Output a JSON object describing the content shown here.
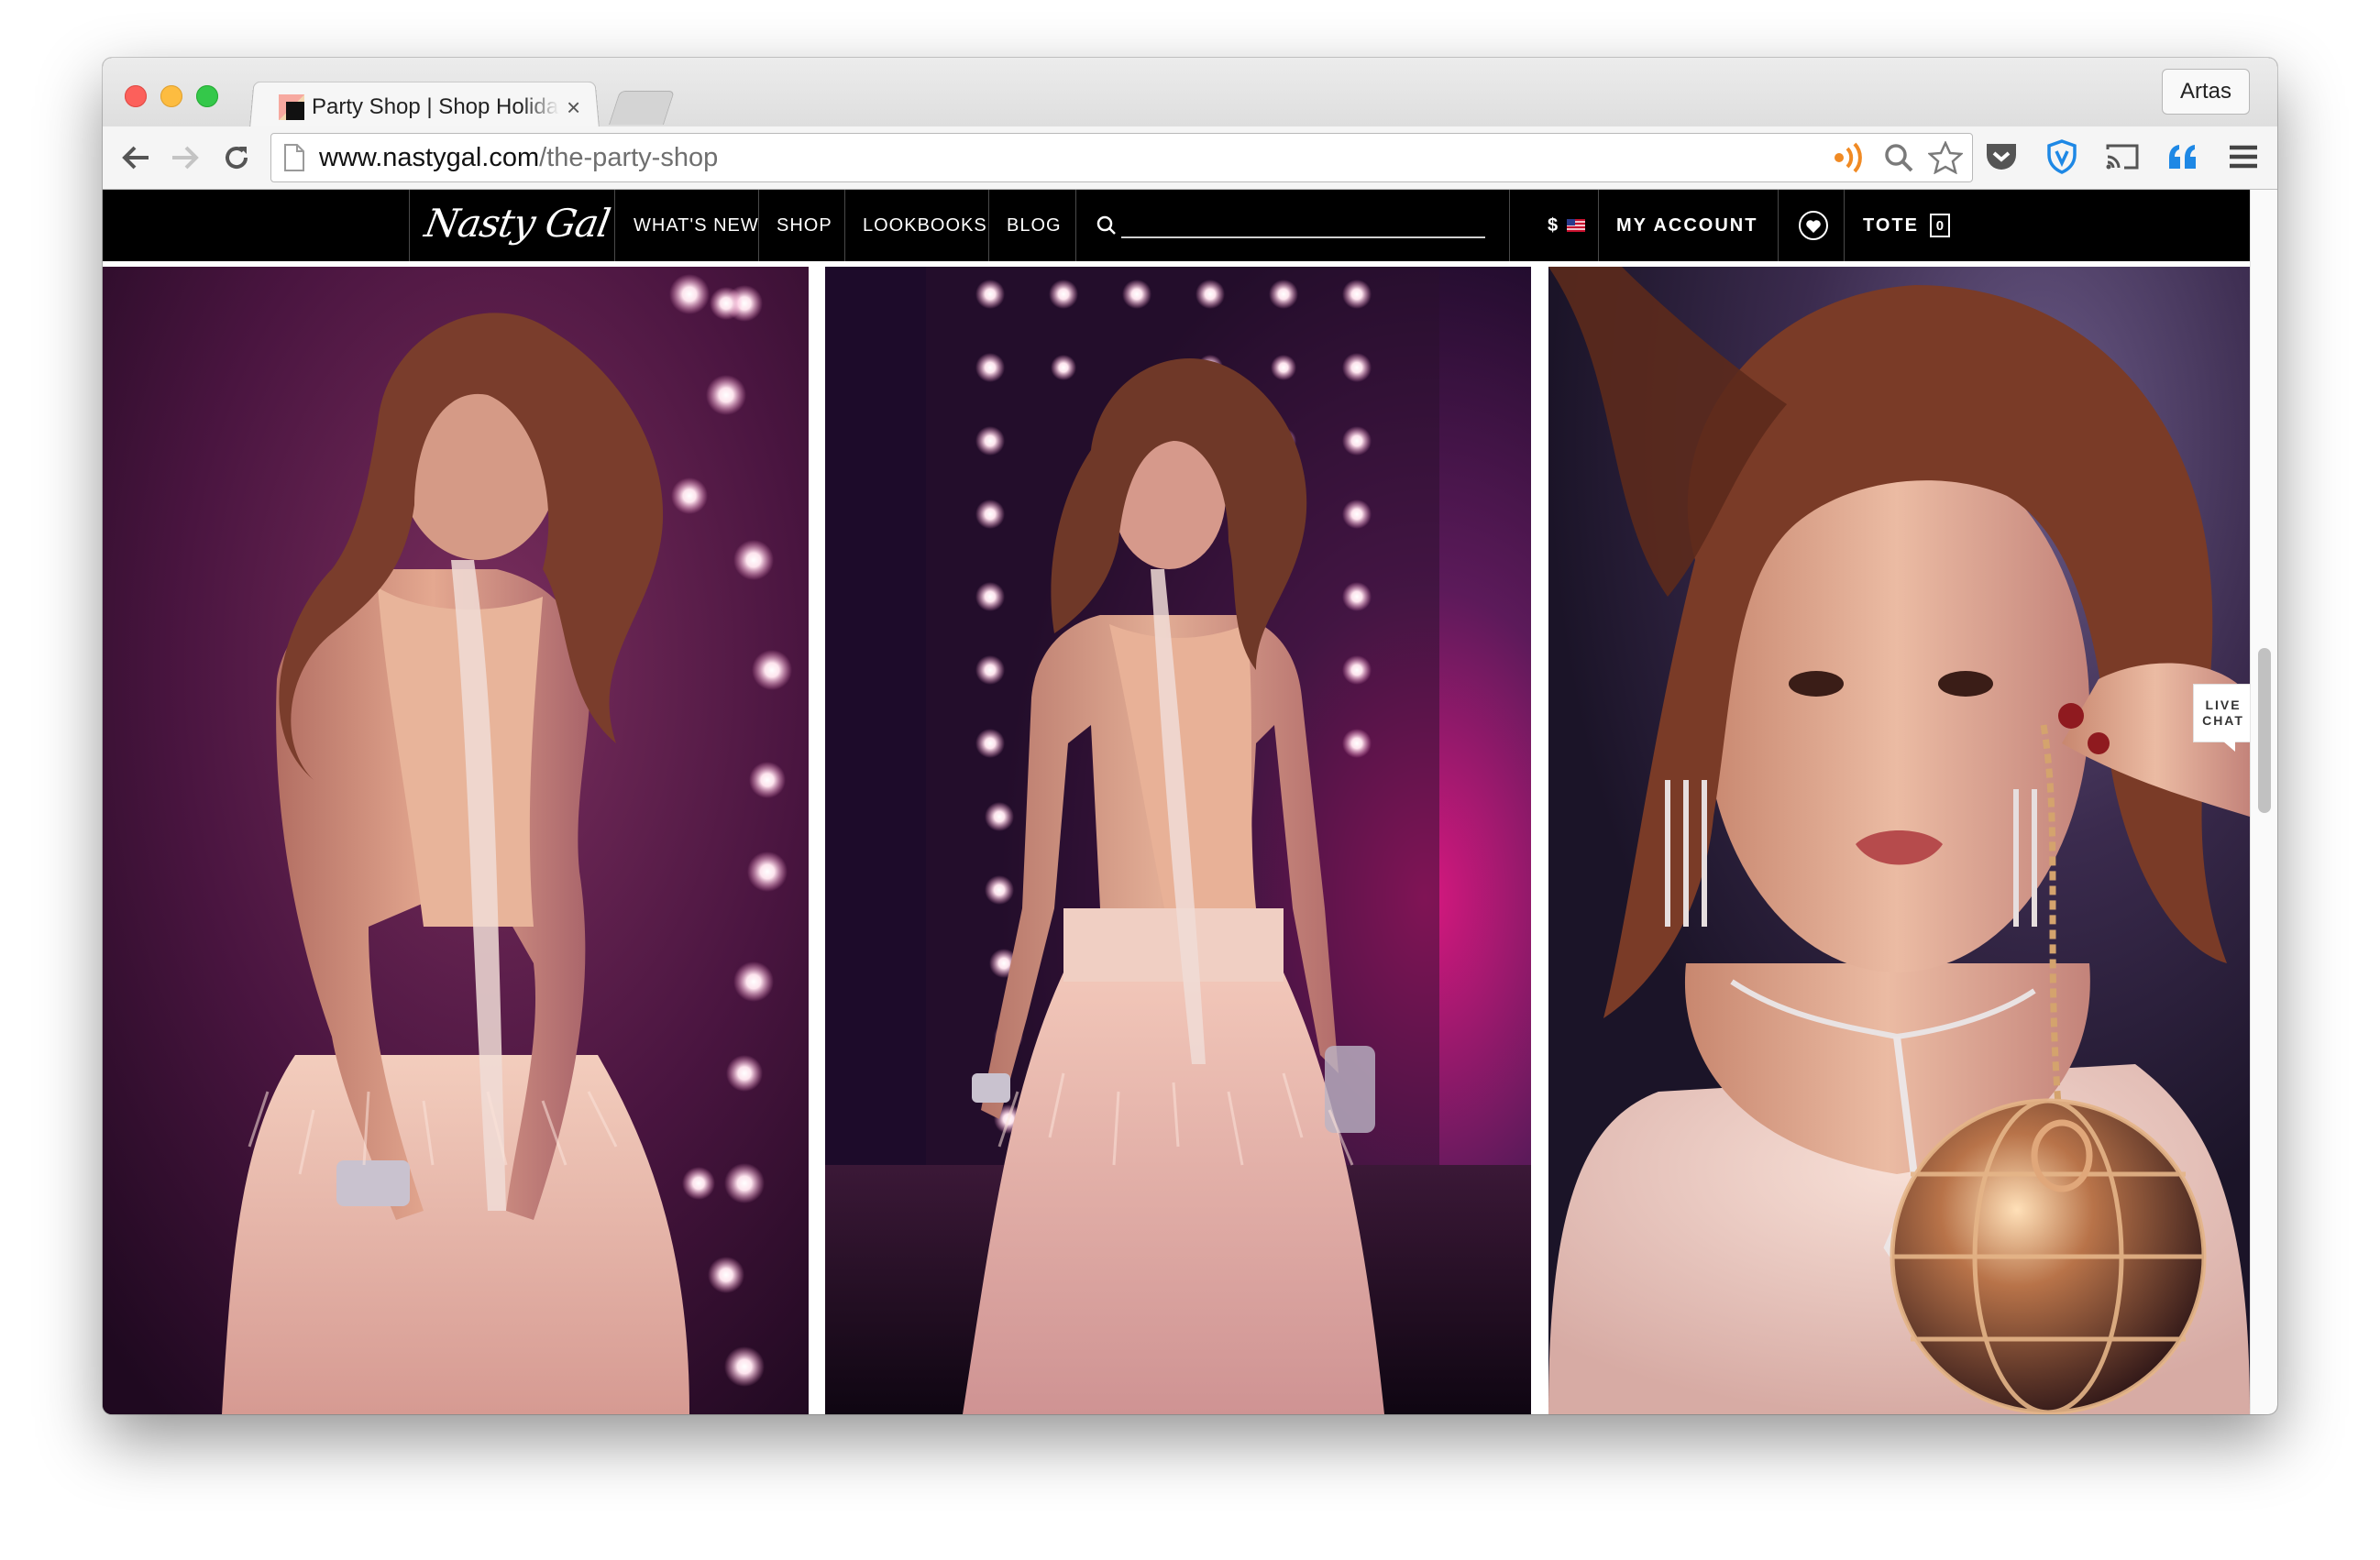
{
  "browser": {
    "tab_title": "Party Shop | Shop Holiday",
    "tab_close": "×",
    "profile_name": "Artas",
    "url_host": "www.nastygal.com",
    "url_path": "/the-party-shop"
  },
  "site": {
    "logo": "Nasty Gal",
    "nav": [
      "WHAT'S NEW",
      "SHOP",
      "LOOKBOOKS",
      "BLOG"
    ],
    "currency": "$",
    "my_account": "MY ACCOUNT",
    "tote_label": "TOTE",
    "tote_count": "0",
    "live_chat_line1": "LIVE",
    "live_chat_line2": "CHAT"
  },
  "gallery": {
    "photos": [
      "model-in-feather-skirt-kneeling",
      "model-in-feather-skirt-standing",
      "model-portrait-with-globe-bag"
    ]
  },
  "colors": {
    "site_nav_bg": "#000000",
    "photo_backdrop_purple": "#3a0f3a",
    "photo_backdrop_magenta": "#c3157a",
    "skin_tone": "#e7b39a"
  }
}
